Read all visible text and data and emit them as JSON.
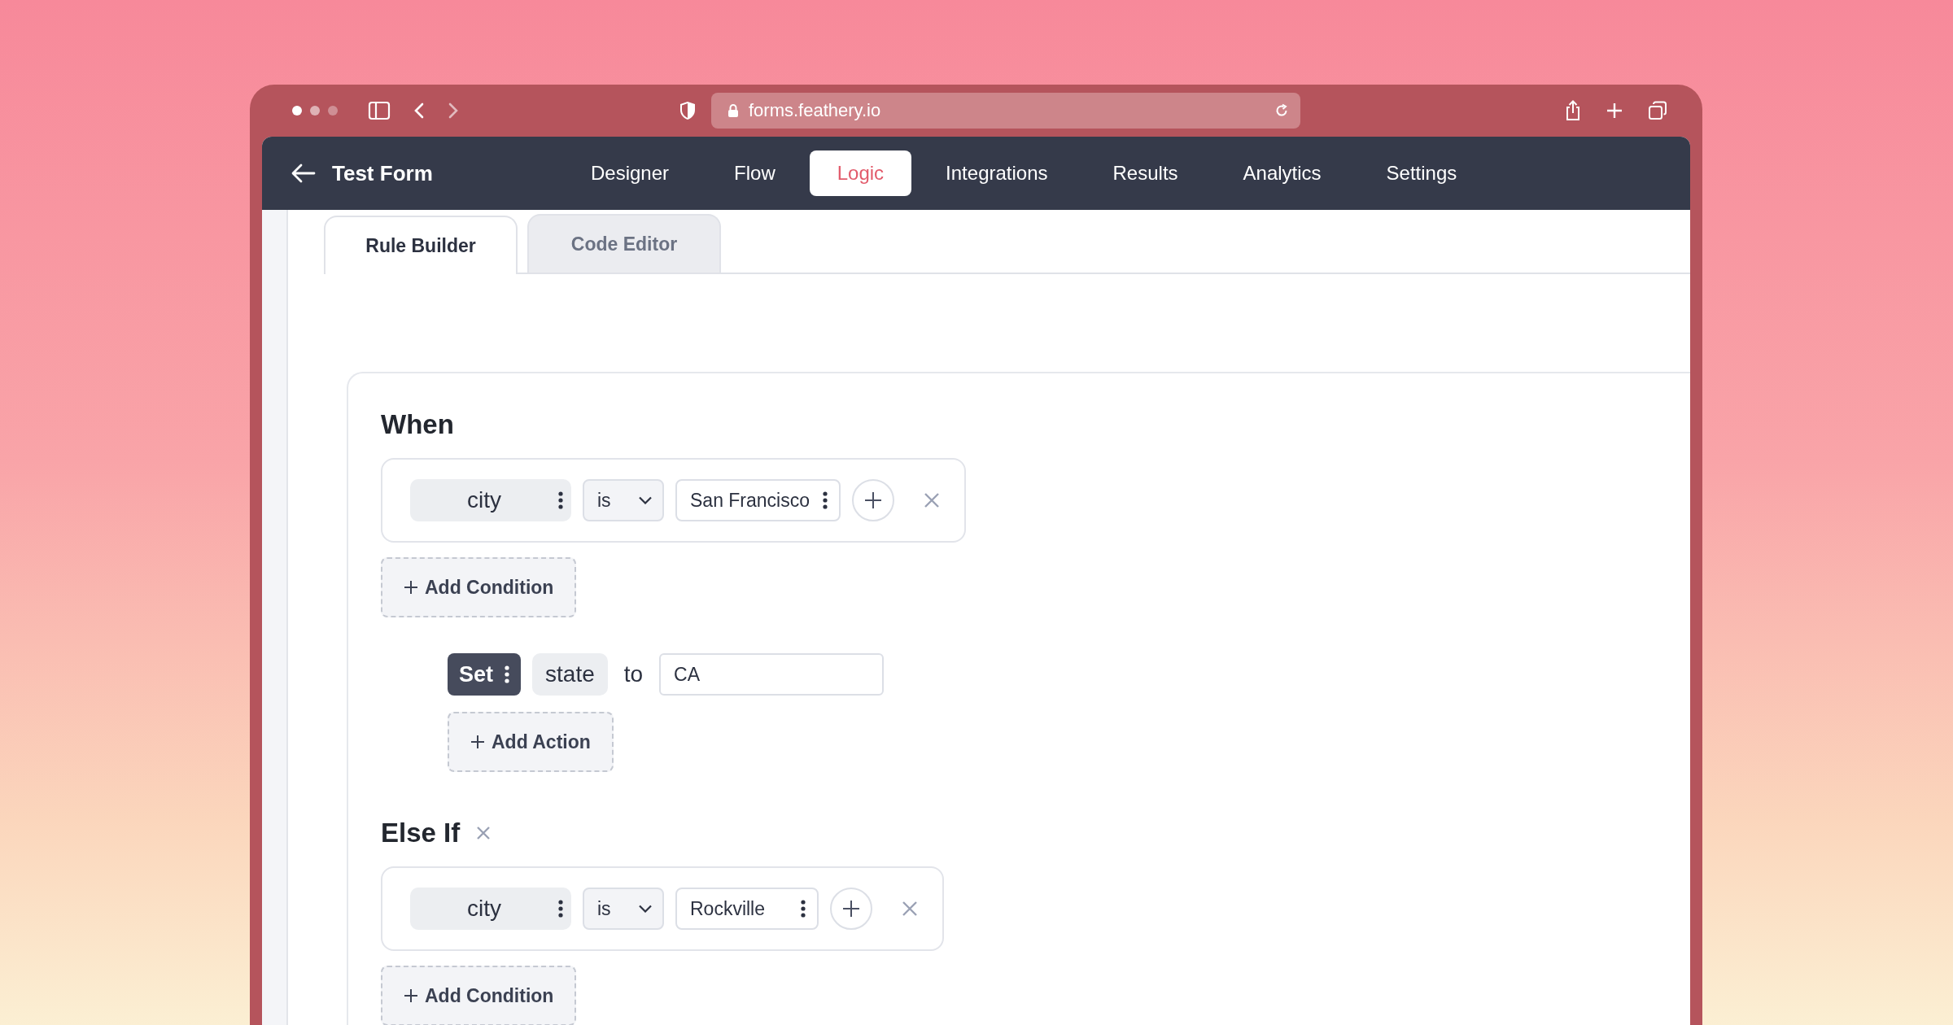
{
  "browser": {
    "url": "forms.feathery.io"
  },
  "header": {
    "title": "Test Form",
    "nav": [
      {
        "label": "Designer",
        "selected": false
      },
      {
        "label": "Flow",
        "selected": false
      },
      {
        "label": "Logic",
        "selected": true
      },
      {
        "label": "Integrations",
        "selected": false
      },
      {
        "label": "Results",
        "selected": false
      },
      {
        "label": "Analytics",
        "selected": false
      },
      {
        "label": "Settings",
        "selected": false
      }
    ]
  },
  "tabs": [
    {
      "label": "Rule Builder",
      "selected": true
    },
    {
      "label": "Code Editor",
      "selected": false
    }
  ],
  "blocks": [
    {
      "heading": "When",
      "removable": false,
      "conditions": [
        {
          "field": "city",
          "operator": "is",
          "value": "San Francisco"
        }
      ],
      "add_condition": "Add Condition",
      "actions": [
        {
          "verb": "Set",
          "field": "state",
          "connector": "to",
          "value": "CA"
        }
      ],
      "add_action": "Add Action"
    },
    {
      "heading": "Else If",
      "removable": true,
      "conditions": [
        {
          "field": "city",
          "operator": "is",
          "value": "Rockville"
        }
      ],
      "add_condition": "Add Condition"
    }
  ]
}
